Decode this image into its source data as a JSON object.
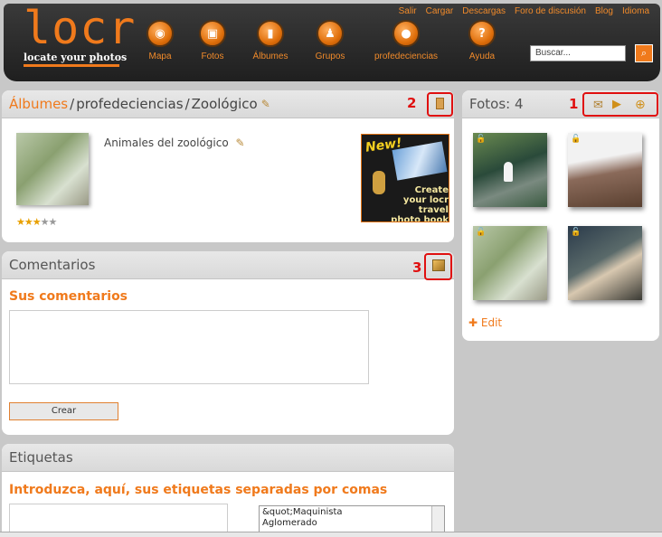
{
  "header": {
    "logo": "locr",
    "tagline": "locate your photos",
    "top_links": [
      "Salir",
      "Cargar",
      "Descargas",
      "Foro de discusión",
      "Blog",
      "Idioma"
    ],
    "nav": [
      {
        "label": "Mapa",
        "icon": "map-icon"
      },
      {
        "label": "Fotos",
        "icon": "camera-icon"
      },
      {
        "label": "Álbumes",
        "icon": "album-icon"
      },
      {
        "label": "Grupos",
        "icon": "groups-icon"
      },
      {
        "label": "profedeciencias",
        "icon": "user-icon"
      },
      {
        "label": "Ayuda",
        "icon": "help-icon"
      }
    ],
    "search_placeholder": "Buscar..."
  },
  "album": {
    "breadcrumb_root": "Álbumes",
    "breadcrumb_user": "profedeciencias",
    "breadcrumb_album": "Zoológico",
    "separator": "/",
    "description": "Animales del zoológico",
    "rating": 3,
    "rating_max": 5,
    "promo_new": "New!",
    "promo_text": "Create your locr travel photo book",
    "marker": "2"
  },
  "fotos": {
    "title": "Fotos: 4",
    "marker": "1",
    "edit_label": "Edit",
    "photos": [
      {
        "subject": "flamingo-pond"
      },
      {
        "subject": "rock-enclosure"
      },
      {
        "subject": "grass-fence"
      },
      {
        "subject": "wooden-tables"
      }
    ]
  },
  "comentarios": {
    "title": "Comentarios",
    "subtitle": "Sus comentarios",
    "button": "Crear",
    "marker": "3"
  },
  "etiquetas": {
    "title": "Etiquetas",
    "subtitle": "Introduzca, aquí, sus etiquetas separadas por comas",
    "tags": [
      "&quot;Maquinista",
      "Aglomerado"
    ]
  },
  "colors": {
    "accent": "#f07a1c",
    "marker": "#e01010"
  }
}
